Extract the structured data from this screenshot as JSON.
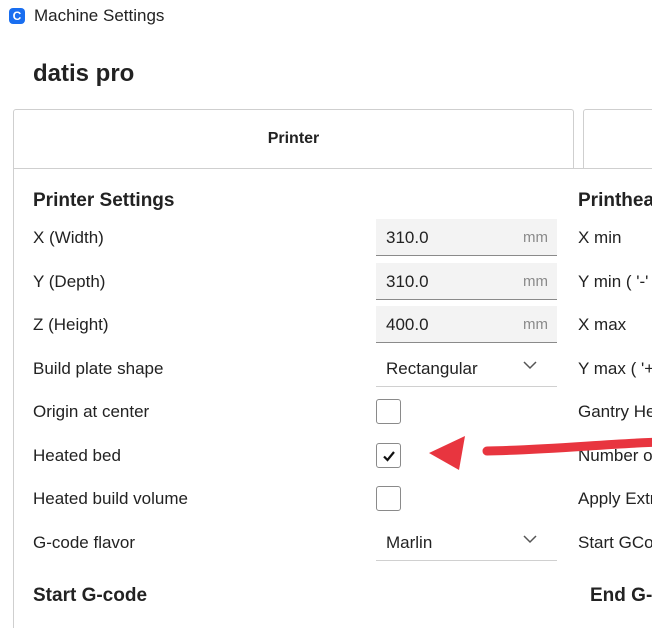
{
  "window": {
    "icon_letter": "C",
    "title": "Machine Settings"
  },
  "machine_name": "datis pro",
  "tabs": [
    {
      "label": "Printer"
    },
    {
      "label": ""
    }
  ],
  "printer_settings": {
    "title": "Printer Settings",
    "x": {
      "label": "X (Width)",
      "value": "310.0",
      "unit": "mm"
    },
    "y": {
      "label": "Y (Depth)",
      "value": "310.0",
      "unit": "mm"
    },
    "z": {
      "label": "Z (Height)",
      "value": "400.0",
      "unit": "mm"
    },
    "build_plate": {
      "label": "Build plate shape",
      "value": "Rectangular"
    },
    "origin": {
      "label": "Origin at center",
      "checked": false
    },
    "heated_bed": {
      "label": "Heated bed",
      "checked": true
    },
    "heated_volume": {
      "label": "Heated build volume",
      "checked": false
    },
    "gcode_flavor": {
      "label": "G-code flavor",
      "value": "Marlin"
    }
  },
  "printhead_settings": {
    "title": "Printhea",
    "labels": [
      "X min",
      "Y min ( '-'",
      "X max",
      "Y max ( '+",
      "Gantry He",
      "Number o",
      "Apply Extr",
      "Start GCo"
    ]
  },
  "start_gcode": {
    "title": "Start G-code"
  },
  "end_gcode": {
    "title": "End G-"
  },
  "colors": {
    "accent": "#196ef0",
    "arrow": "#e8353f"
  }
}
